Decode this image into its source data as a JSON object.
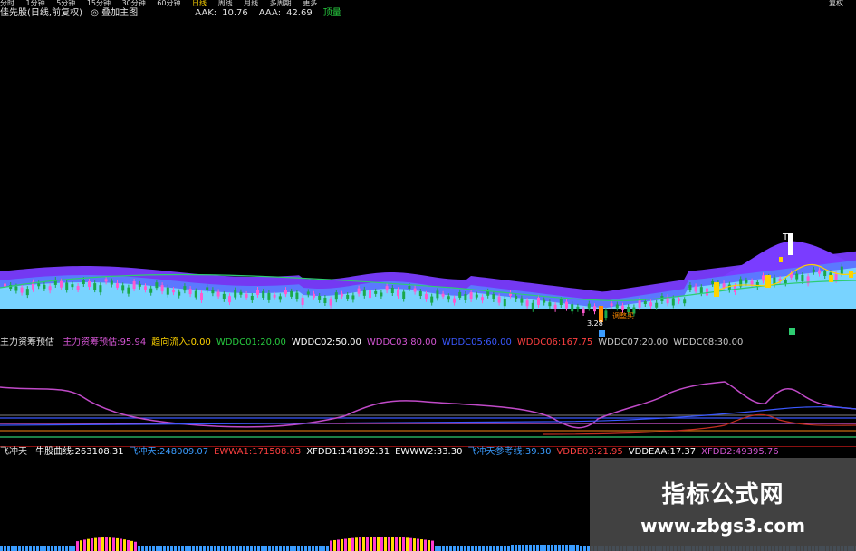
{
  "toolbar": {
    "items": [
      "分时",
      "1分钟",
      "5分钟",
      "15分钟",
      "30分钟",
      "60分钟",
      "日线",
      "周线",
      "月线",
      "多周期",
      "更多"
    ],
    "right_label": "复权"
  },
  "title_bar": {
    "name": "佳先股(日线,前复权)",
    "toggle": "◎ 叠加主图",
    "fields": [
      {
        "label": "AAK:",
        "value": "10.76",
        "color": "#e0e0e0"
      },
      {
        "label": "AAA:",
        "value": "42.69",
        "color": "#e0e0e0"
      },
      {
        "label": "",
        "value": "顶量",
        "color": "#27c93f"
      }
    ]
  },
  "indicator1": {
    "name": "主力资筹预估",
    "fields": [
      {
        "label": "主力资筹预估:",
        "value": "95.94",
        "color": "#d455d4"
      },
      {
        "label": "趋向流入:",
        "value": "0.00",
        "color": "#ffd400"
      },
      {
        "label": "WDDC01:",
        "value": "20.00",
        "color": "#27c93f"
      },
      {
        "label": "WDDC02:",
        "value": "50.00",
        "color": "#ffffff"
      },
      {
        "label": "WDDC03:",
        "value": "80.00",
        "color": "#d455d4"
      },
      {
        "label": "WDDC05:",
        "value": "60.00",
        "color": "#3a58ff"
      },
      {
        "label": "WDDC06:",
        "value": "167.75",
        "color": "#ff4040"
      },
      {
        "label": "WDDC07:",
        "value": "20.00",
        "color": "#c8c8c8"
      },
      {
        "label": "WDDC08:",
        "value": "30.00",
        "color": "#c8c8c8"
      }
    ]
  },
  "indicator2": {
    "name": "飞冲天",
    "fields": [
      {
        "label": "牛股曲线:",
        "value": "263108.31",
        "color": "#ffffff"
      },
      {
        "label": "飞冲天:",
        "value": "248009.07",
        "color": "#3a9cff"
      },
      {
        "label": "EWWA1:",
        "value": "171508.03",
        "color": "#ff4040"
      },
      {
        "label": "XFDD1:",
        "value": "141892.31",
        "color": "#ffffff"
      },
      {
        "label": "EWWW2:",
        "value": "33.30",
        "color": "#ffffff"
      },
      {
        "label": "飞冲天参考线:",
        "value": "39.30",
        "color": "#3a9cff"
      },
      {
        "label": "VDDE03:",
        "value": "21.95",
        "color": "#ff4040"
      },
      {
        "label": "VDDEAA:",
        "value": "17.37",
        "color": "#ffffff"
      },
      {
        "label": "XFDD2:",
        "value": "49395.76",
        "color": "#d455d4"
      }
    ]
  },
  "annotations": {
    "top_marker": "T",
    "low_price": "3.28",
    "low_note": "调整买"
  },
  "watermark": {
    "title": "指标公式网",
    "url": "www.zbgs3.com"
  },
  "colors": {
    "up": "#ff5ad0",
    "down": "#1aa84a",
    "ma": "#2ecc71",
    "ribbon_light": "#7ad8ff",
    "ribbon_mid": "#5a7bff",
    "ribbon_dark": "#7a3cff",
    "osc": "#c04ac8",
    "signal": "#ffd400"
  }
}
